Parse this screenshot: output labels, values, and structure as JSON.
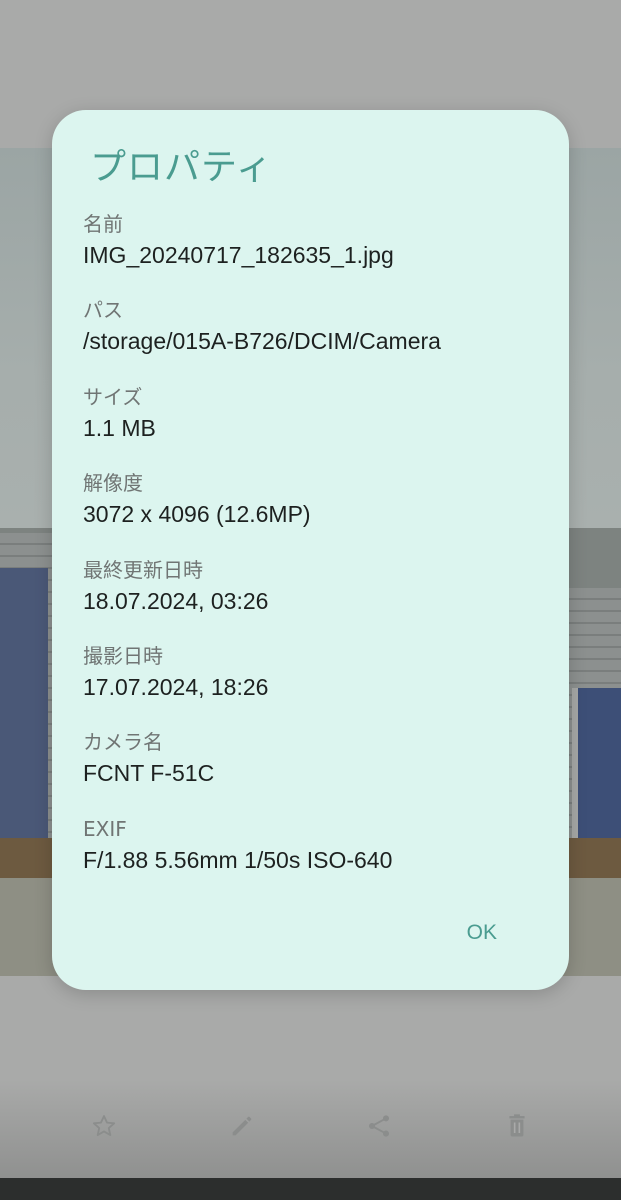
{
  "dialog": {
    "title": "プロパティ",
    "ok_label": "OK",
    "properties": [
      {
        "label": "名前",
        "value": "IMG_20240717_182635_1.jpg"
      },
      {
        "label": "パス",
        "value": "/storage/015A-B726/DCIM/Camera"
      },
      {
        "label": "サイズ",
        "value": "1.1 MB"
      },
      {
        "label": "解像度",
        "value": "3072 x 4096 (12.6MP)"
      },
      {
        "label": "最終更新日時",
        "value": "18.07.2024, 03:26"
      },
      {
        "label": "撮影日時",
        "value": "17.07.2024, 18:26"
      },
      {
        "label": "カメラ名",
        "value": "FCNT F-51C"
      },
      {
        "label": "EXIF",
        "value": "F/1.88  5.56mm  1/50s  ISO-640"
      }
    ]
  },
  "action_bar": {
    "icons": [
      "star-icon",
      "edit-icon",
      "share-icon",
      "delete-icon"
    ]
  },
  "colors": {
    "dialog_bg": "#dcf5ef",
    "accent": "#4a9c90",
    "icon": "#8b8d8c"
  }
}
